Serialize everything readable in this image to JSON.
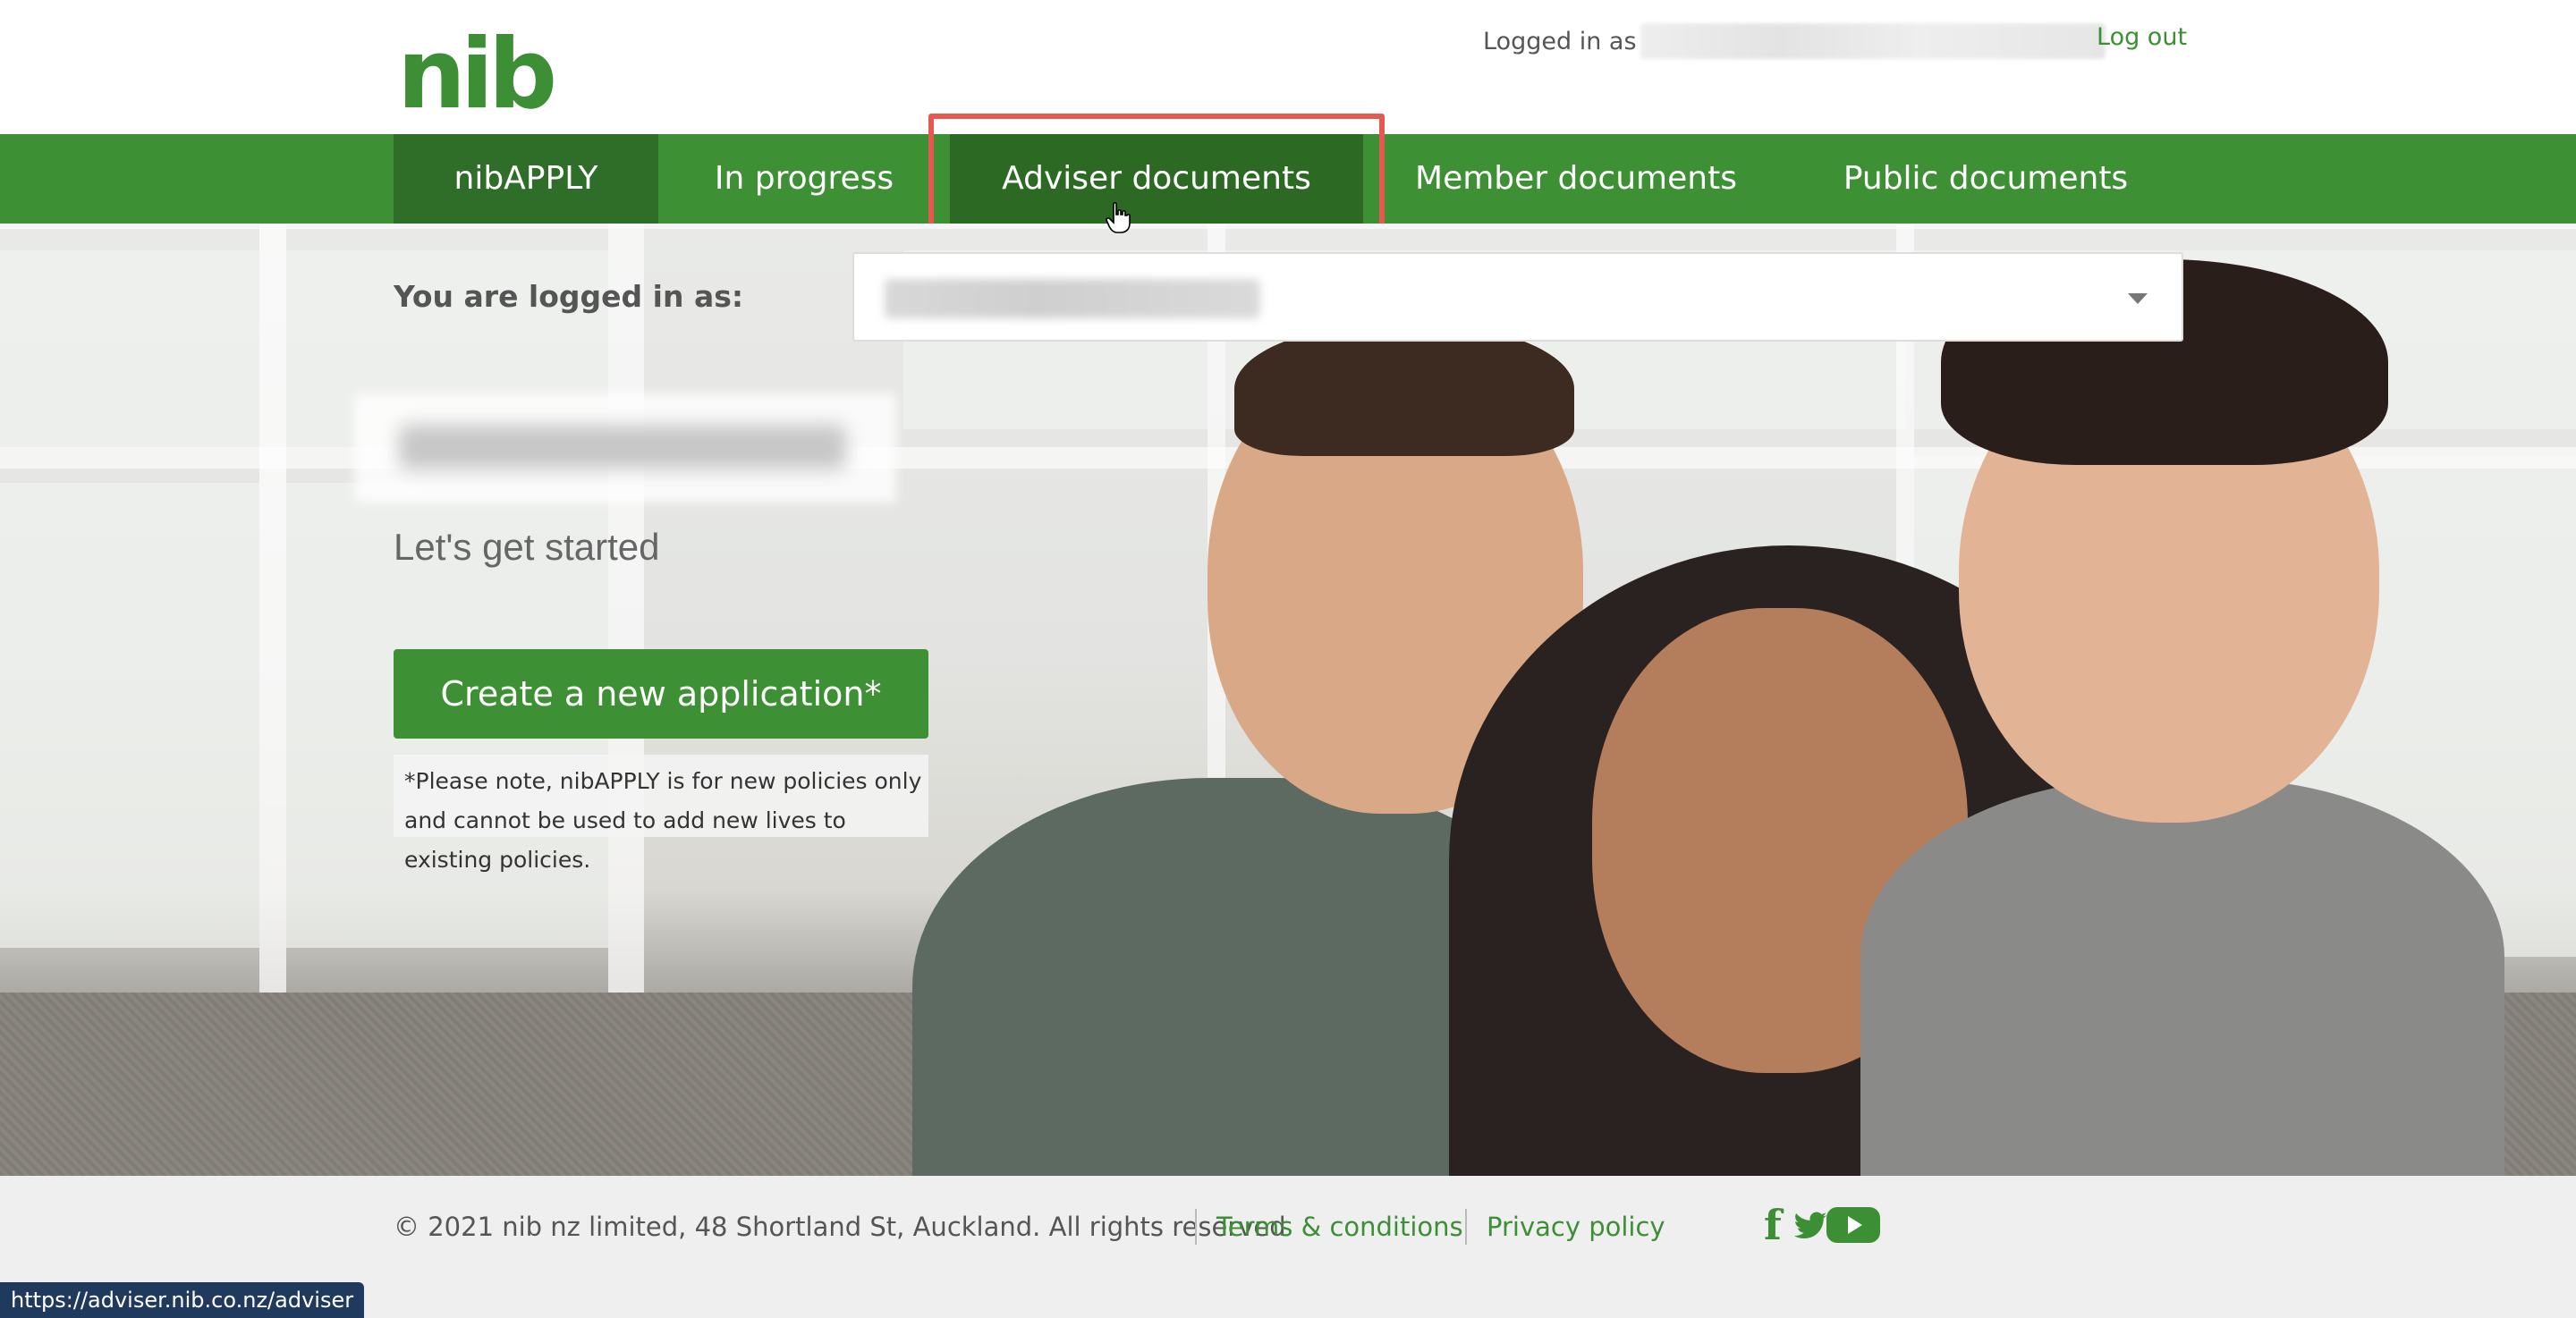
{
  "header": {
    "logo_text": "nib",
    "logged_in_label": "Logged in as",
    "logout_label": "Log out"
  },
  "nav": {
    "items": [
      {
        "label": "nibAPPLY"
      },
      {
        "label": "In progress"
      },
      {
        "label": "Adviser documents"
      },
      {
        "label": "Member documents"
      },
      {
        "label": "Public documents"
      }
    ]
  },
  "main": {
    "logged_in_as_label": "You are logged in as:",
    "start_text": "Let's get started",
    "create_button_label": "Create a new application*",
    "note": "*Please note, nibAPPLY is for new policies only and cannot be used to add new lives to existing policies."
  },
  "footer": {
    "copyright": "© 2021 nib nz limited, 48 Shortland St, Auckland. All rights reserved",
    "terms_label": "Terms & conditions",
    "privacy_label": "Privacy policy"
  },
  "status_bar": {
    "url": "https://adviser.nib.co.nz/adviser"
  },
  "colors": {
    "brand_green": "#3e9035",
    "nav_active": "#2f6e28",
    "highlight_red": "#e55a50"
  },
  "icons": [
    "facebook-icon",
    "twitter-icon",
    "youtube-icon",
    "chevron-down-icon",
    "hand-cursor-icon"
  ]
}
